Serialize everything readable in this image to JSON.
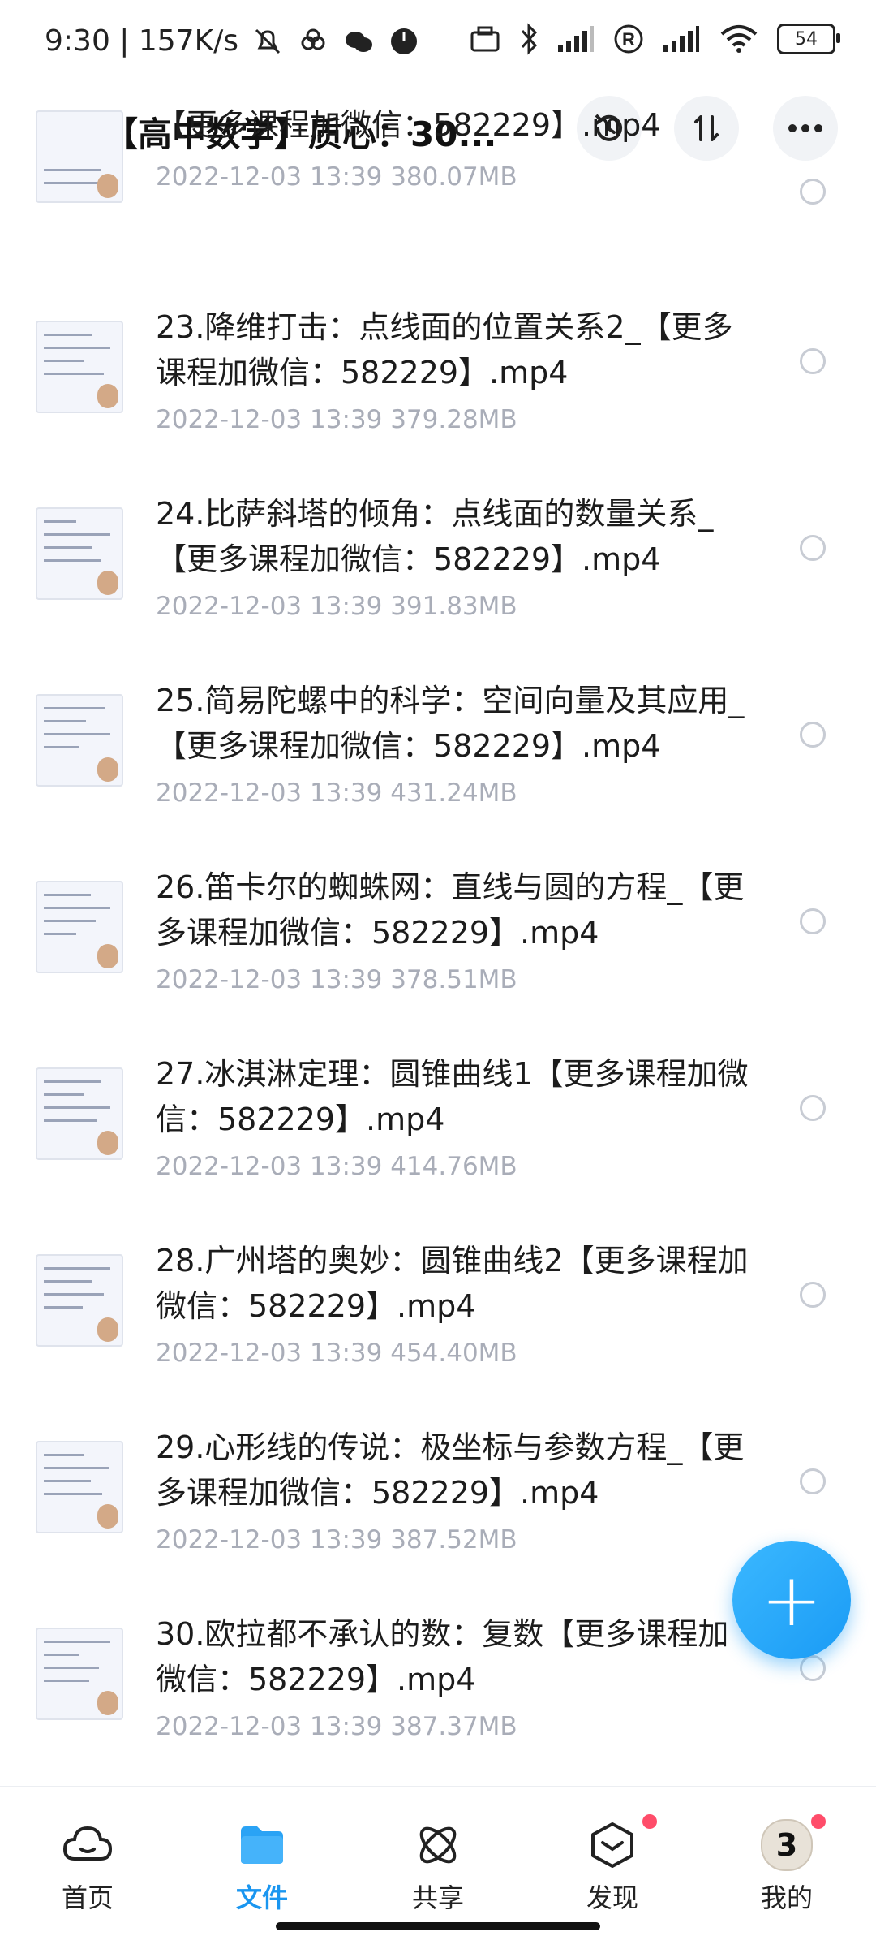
{
  "status": {
    "time_speed": "9:30 | 157K/s",
    "battery": "54",
    "signal_sub": "6"
  },
  "header": {
    "title": "【高中数学】质心：30..."
  },
  "files": [
    {
      "name": "【更多课程加微信：582229】.mp4",
      "meta": "2022-12-03  13:39  380.07MB"
    },
    {
      "name": "23.降维打击：点线面的位置关系2_【更多课程加微信：582229】.mp4",
      "meta": "2022-12-03  13:39  379.28MB"
    },
    {
      "name": "24.比萨斜塔的倾角：点线面的数量关系_【更多课程加微信：582229】.mp4",
      "meta": "2022-12-03  13:39  391.83MB"
    },
    {
      "name": "25.简易陀螺中的科学：空间向量及其应用_【更多课程加微信：582229】.mp4",
      "meta": "2022-12-03  13:39  431.24MB"
    },
    {
      "name": "26.笛卡尔的蜘蛛网：直线与圆的方程_【更多课程加微信：582229】.mp4",
      "meta": "2022-12-03  13:39  378.51MB"
    },
    {
      "name": "27.冰淇淋定理：圆锥曲线1【更多课程加微信：582229】.mp4",
      "meta": "2022-12-03  13:39  414.76MB"
    },
    {
      "name": "28.广州塔的奥妙：圆锥曲线2【更多课程加微信：582229】.mp4",
      "meta": "2022-12-03  13:39  454.40MB"
    },
    {
      "name": "29.心形线的传说：极坐标与参数方程_【更多课程加微信：582229】.mp4",
      "meta": "2022-12-03  13:39  387.52MB"
    },
    {
      "name": "30.欧拉都不承认的数：复数【更多课程加微信：582229】.mp4",
      "meta": "2022-12-03  13:39  387.37MB"
    }
  ],
  "fab": {
    "symbol": "+"
  },
  "nav": [
    {
      "label": "首页",
      "icon": "cloud-icon"
    },
    {
      "label": "文件",
      "icon": "folder-icon"
    },
    {
      "label": "共享",
      "icon": "share-orbit-icon"
    },
    {
      "label": "发现",
      "icon": "cube-icon"
    },
    {
      "label": "我的",
      "icon": "avatar-icon"
    }
  ],
  "avatar_badge": "3",
  "colors": {
    "accent": "#1a96f0",
    "notify": "#ff4d6a"
  }
}
